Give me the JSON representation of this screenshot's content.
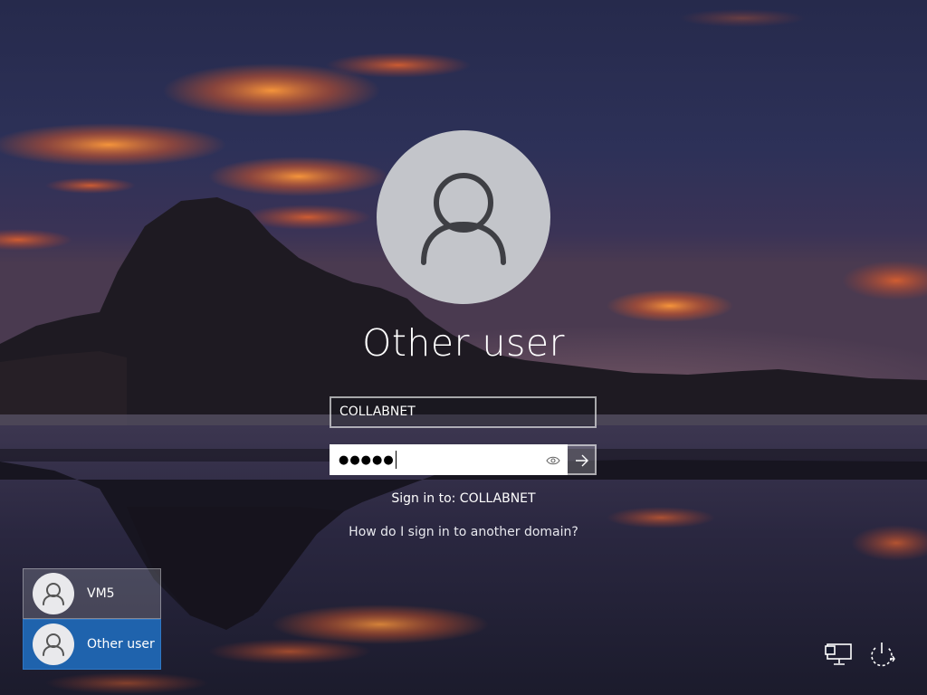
{
  "signin": {
    "display_name": "Other user",
    "username_value": "COLLABNET",
    "password_mask": "●●●●●",
    "password_icon": "reveal-password-eye-icon",
    "submit_icon": "arrow-right-icon",
    "signin_to": "Sign in to: COLLABNET",
    "another_domain_link": "How do I sign in to another domain?"
  },
  "users": [
    {
      "label": "VM5",
      "selected": false
    },
    {
      "label": "Other user",
      "selected": true
    }
  ],
  "system_icons": {
    "network": "network-icon",
    "power": "power-icon"
  },
  "colors": {
    "selected_user_bg": "#1f63ad",
    "avatar_bg": "#c3c5ca",
    "text": "#ffffff"
  }
}
